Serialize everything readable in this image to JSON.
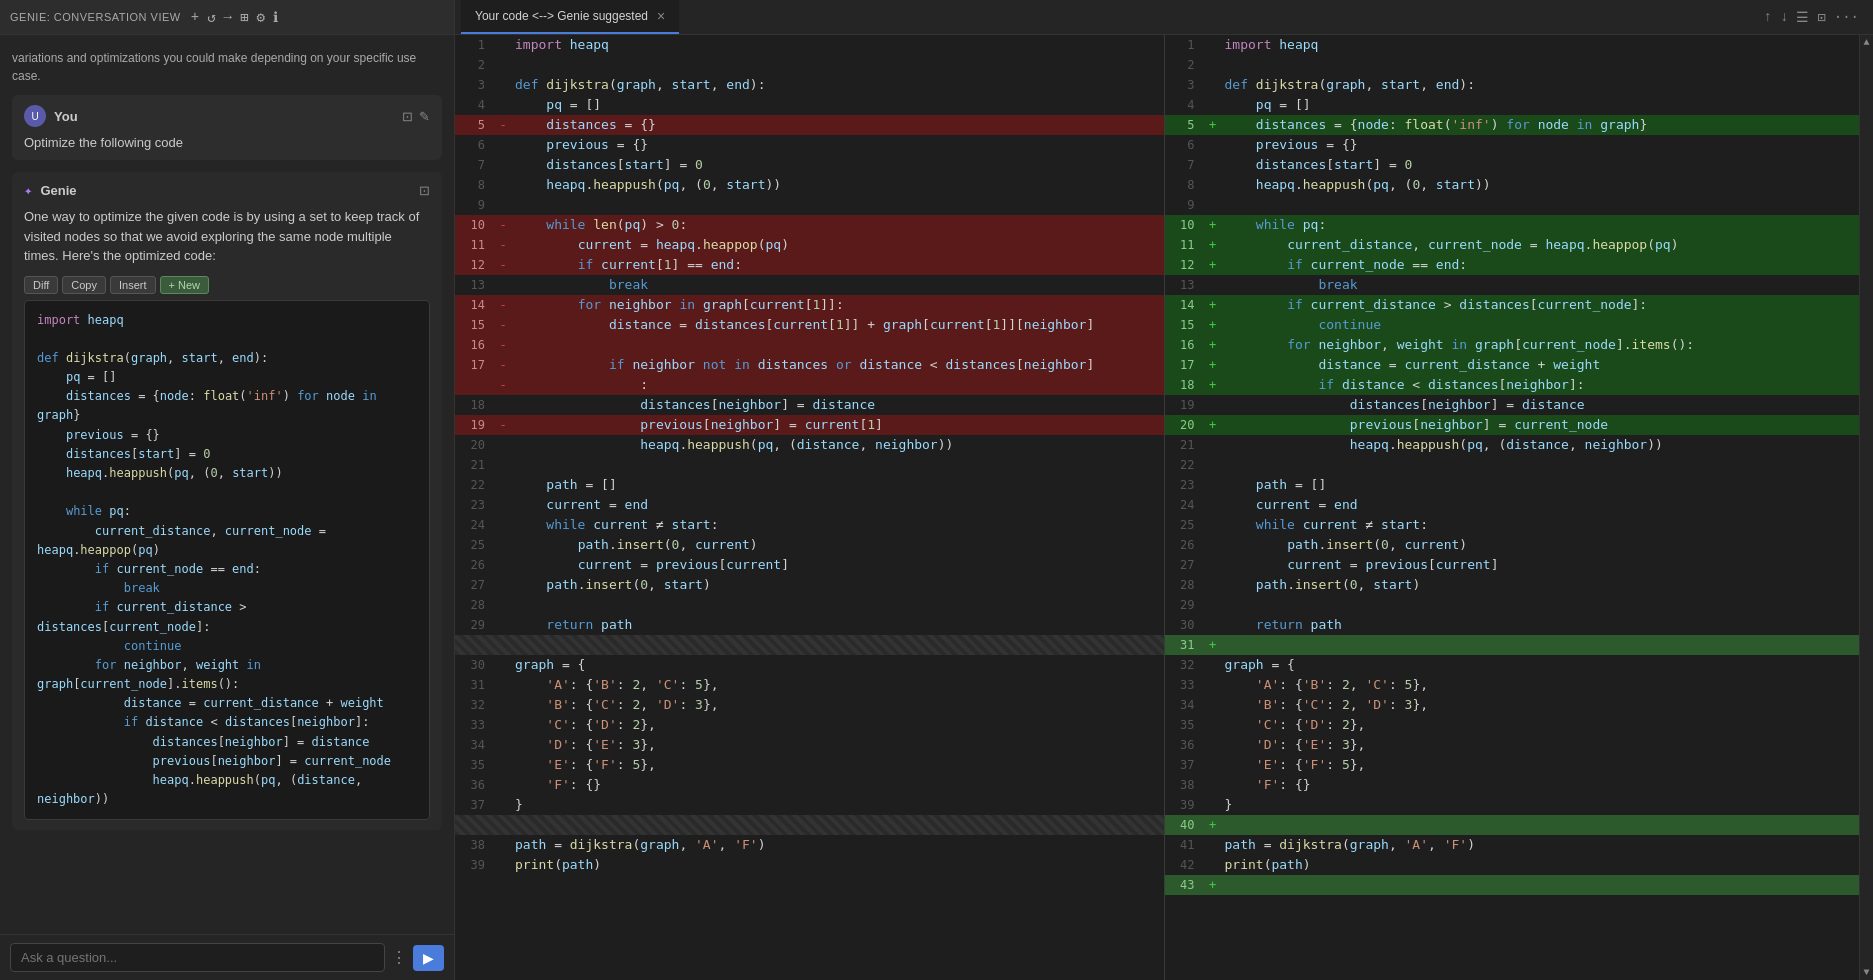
{
  "topbar": {
    "title": "GENIE: CONVERSATION VIEW",
    "icons": [
      "+",
      "↺",
      "→",
      "⊞",
      "⚙",
      "ℹ"
    ]
  },
  "tabs": {
    "items": [
      {
        "label": "Your code <--> Genie suggested",
        "active": true,
        "closable": true
      }
    ],
    "right_icons": [
      "↑",
      "↓",
      "☰",
      "⊡",
      "..."
    ]
  },
  "chat": {
    "prior_text": "variations and optimizations you could make depending on your specific use case.",
    "user": {
      "name": "You",
      "message": "Optimize the following code"
    },
    "genie": {
      "name": "Genie",
      "message": "One way to optimize the given code is by using a set to keep track of visited nodes so that we avoid exploring the same node multiple times. Here's the optimized code:",
      "toolbar": {
        "diff_label": "Diff",
        "copy_label": "Copy",
        "insert_label": "Insert",
        "new_label": "+ New"
      },
      "code": [
        "import heapq",
        "",
        "def dijkstra(graph, start, end):",
        "    pq = []",
        "    distances = {node: float('inf') for node in graph}",
        "    previous = {}",
        "    distances[start] = 0",
        "    heapq.heappush(pq, (0, start))",
        "",
        "    while pq:",
        "        current_distance, current_node = heapq.heappop(pq)",
        "        if current_node == end:",
        "            break",
        "        if current_distance > distances[current_node]:",
        "            continue",
        "        for neighbor, weight in graph[current_node].items():",
        "            distance = current_distance + weight",
        "            if distance < distances[neighbor]:",
        "                distances[neighbor] = distance",
        "                previous[neighbor] = current_node",
        "                heapq.heappush(pq, (distance, neighbor))"
      ]
    },
    "input_placeholder": "Ask a question..."
  },
  "left_panel_lines": [
    {
      "num": "1",
      "marker": "",
      "code": "import heapq",
      "type": "normal"
    },
    {
      "num": "2",
      "marker": "",
      "code": "",
      "type": "normal"
    },
    {
      "num": "3",
      "marker": "",
      "code": "def dijkstra(graph, start, end):",
      "type": "normal"
    },
    {
      "num": "4",
      "marker": "",
      "code": "    pq = []",
      "type": "normal"
    },
    {
      "num": "5",
      "marker": "-",
      "code": "    distances = {}",
      "type": "removed"
    },
    {
      "num": "6",
      "marker": "",
      "code": "    previous = {}",
      "type": "normal"
    },
    {
      "num": "7",
      "marker": "",
      "code": "    distances[start] = 0",
      "type": "normal"
    },
    {
      "num": "8",
      "marker": "",
      "code": "    heapq.heappush(pq, (0, start))",
      "type": "normal"
    },
    {
      "num": "9",
      "marker": "",
      "code": "",
      "type": "normal"
    },
    {
      "num": "10",
      "marker": "-",
      "code": "    while len(pq) > 0:",
      "type": "removed"
    },
    {
      "num": "11",
      "marker": "-",
      "code": "        current = heapq.heappop(pq)",
      "type": "removed"
    },
    {
      "num": "12",
      "marker": "-",
      "code": "        if current[1] == end:",
      "type": "removed"
    },
    {
      "num": "13",
      "marker": "",
      "code": "            break",
      "type": "normal"
    },
    {
      "num": "14",
      "marker": "-",
      "code": "        for neighbor in graph[current[1]]:",
      "type": "removed"
    },
    {
      "num": "15",
      "marker": "-",
      "code": "            distance = distances[current[1]] + graph[current[1]][neighbor]",
      "type": "removed"
    },
    {
      "num": "16",
      "marker": "-",
      "code": "",
      "type": "removed"
    },
    {
      "num": "17",
      "marker": "-",
      "code": "            if neighbor not in distances or distance < distances[neighbor]",
      "type": "removed"
    },
    {
      "num": "",
      "marker": "",
      "code": "                :",
      "type": "removed"
    },
    {
      "num": "18",
      "marker": "",
      "code": "                distances[neighbor] = distance",
      "type": "normal"
    },
    {
      "num": "19",
      "marker": "-",
      "code": "                previous[neighbor] = current[1]",
      "type": "removed"
    },
    {
      "num": "20",
      "marker": "",
      "code": "                heapq.heappush(pq, (distance, neighbor))",
      "type": "normal"
    },
    {
      "num": "21",
      "marker": "",
      "code": "",
      "type": "normal"
    },
    {
      "num": "22",
      "marker": "",
      "code": "    path = []",
      "type": "normal"
    },
    {
      "num": "23",
      "marker": "",
      "code": "    current = end",
      "type": "normal"
    },
    {
      "num": "24",
      "marker": "",
      "code": "    while current ≠ start:",
      "type": "normal"
    },
    {
      "num": "25",
      "marker": "",
      "code": "        path.insert(0, current)",
      "type": "normal"
    },
    {
      "num": "26",
      "marker": "",
      "code": "        current = previous[current]",
      "type": "normal"
    },
    {
      "num": "27",
      "marker": "",
      "code": "    path.insert(0, start)",
      "type": "normal"
    },
    {
      "num": "28",
      "marker": "",
      "code": "",
      "type": "normal"
    },
    {
      "num": "29",
      "marker": "",
      "code": "    return path",
      "type": "normal"
    },
    {
      "num": "",
      "marker": "",
      "code": "",
      "type": "separator"
    },
    {
      "num": "30",
      "marker": "",
      "code": "graph = {",
      "type": "normal"
    },
    {
      "num": "31",
      "marker": "",
      "code": "    'A': {'B': 2, 'C': 5},",
      "type": "normal"
    },
    {
      "num": "32",
      "marker": "",
      "code": "    'B': {'C': 2, 'D': 3},",
      "type": "normal"
    },
    {
      "num": "33",
      "marker": "",
      "code": "    'C': {'D': 2},",
      "type": "normal"
    },
    {
      "num": "34",
      "marker": "",
      "code": "    'D': {'E': 3},",
      "type": "normal"
    },
    {
      "num": "35",
      "marker": "",
      "code": "    'E': {'F': 5},",
      "type": "normal"
    },
    {
      "num": "36",
      "marker": "",
      "code": "    'F': {}",
      "type": "normal"
    },
    {
      "num": "37",
      "marker": "",
      "code": "}",
      "type": "normal"
    },
    {
      "num": "",
      "marker": "",
      "code": "",
      "type": "separator"
    },
    {
      "num": "38",
      "marker": "",
      "code": "path = dijkstra(graph, 'A', 'F')",
      "type": "normal"
    },
    {
      "num": "39",
      "marker": "",
      "code": "print(path)",
      "type": "normal"
    }
  ],
  "right_panel_lines": [
    {
      "num": "1",
      "marker": "",
      "code": "import heapq",
      "type": "normal"
    },
    {
      "num": "2",
      "marker": "",
      "code": "",
      "type": "normal"
    },
    {
      "num": "3",
      "marker": "",
      "code": "def dijkstra(graph, start, end):",
      "type": "normal"
    },
    {
      "num": "4",
      "marker": "",
      "code": "    pq = []",
      "type": "normal"
    },
    {
      "num": "5",
      "marker": "+",
      "code": "    distances = {node: float('inf') for node in graph}",
      "type": "added"
    },
    {
      "num": "6",
      "marker": "",
      "code": "    previous = {}",
      "type": "normal"
    },
    {
      "num": "7",
      "marker": "",
      "code": "    distances[start] = 0",
      "type": "normal"
    },
    {
      "num": "8",
      "marker": "",
      "code": "    heapq.heappush(pq, (0, start))",
      "type": "normal"
    },
    {
      "num": "9",
      "marker": "",
      "code": "",
      "type": "normal"
    },
    {
      "num": "10",
      "marker": "+",
      "code": "    while pq:",
      "type": "added"
    },
    {
      "num": "11",
      "marker": "+",
      "code": "        current_distance, current_node = heapq.heappop(pq)",
      "type": "added"
    },
    {
      "num": "12",
      "marker": "+",
      "code": "        if current_node == end:",
      "type": "added"
    },
    {
      "num": "13",
      "marker": "",
      "code": "            break",
      "type": "normal"
    },
    {
      "num": "14",
      "marker": "+",
      "code": "        if current_distance > distances[current_node]:",
      "type": "added"
    },
    {
      "num": "15",
      "marker": "+",
      "code": "            continue",
      "type": "added"
    },
    {
      "num": "16",
      "marker": "+",
      "code": "        for neighbor, weight in graph[current_node].items():",
      "type": "added"
    },
    {
      "num": "17",
      "marker": "+",
      "code": "            distance = current_distance + weight",
      "type": "added"
    },
    {
      "num": "18",
      "marker": "+",
      "code": "            if distance < distances[neighbor]:",
      "type": "added"
    },
    {
      "num": "19",
      "marker": "",
      "code": "                distances[neighbor] = distance",
      "type": "normal"
    },
    {
      "num": "20",
      "marker": "+",
      "code": "                previous[neighbor] = current_node",
      "type": "added"
    },
    {
      "num": "21",
      "marker": "",
      "code": "                heapq.heappush(pq, (distance, neighbor))",
      "type": "normal"
    },
    {
      "num": "22",
      "marker": "",
      "code": "",
      "type": "normal"
    },
    {
      "num": "23",
      "marker": "",
      "code": "    path = []",
      "type": "normal"
    },
    {
      "num": "24",
      "marker": "",
      "code": "    current = end",
      "type": "normal"
    },
    {
      "num": "25",
      "marker": "",
      "code": "    while current ≠ start:",
      "type": "normal"
    },
    {
      "num": "26",
      "marker": "",
      "code": "        path.insert(0, current)",
      "type": "normal"
    },
    {
      "num": "27",
      "marker": "",
      "code": "        current = previous[current]",
      "type": "normal"
    },
    {
      "num": "28",
      "marker": "",
      "code": "    path.insert(0, start)",
      "type": "normal"
    },
    {
      "num": "29",
      "marker": "",
      "code": "",
      "type": "normal"
    },
    {
      "num": "30",
      "marker": "",
      "code": "    return path",
      "type": "normal"
    },
    {
      "num": "31",
      "marker": "+",
      "code": "",
      "type": "added-bright"
    },
    {
      "num": "32",
      "marker": "",
      "code": "graph = {",
      "type": "normal"
    },
    {
      "num": "33",
      "marker": "",
      "code": "    'A': {'B': 2, 'C': 5},",
      "type": "normal"
    },
    {
      "num": "34",
      "marker": "",
      "code": "    'B': {'C': 2, 'D': 3},",
      "type": "normal"
    },
    {
      "num": "35",
      "marker": "",
      "code": "    'C': {'D': 2},",
      "type": "normal"
    },
    {
      "num": "36",
      "marker": "",
      "code": "    'D': {'E': 3},",
      "type": "normal"
    },
    {
      "num": "37",
      "marker": "",
      "code": "    'E': {'F': 5},",
      "type": "normal"
    },
    {
      "num": "38",
      "marker": "",
      "code": "    'F': {}",
      "type": "normal"
    },
    {
      "num": "39",
      "marker": "",
      "code": "}",
      "type": "normal"
    },
    {
      "num": "40",
      "marker": "+",
      "code": "",
      "type": "added-bright"
    },
    {
      "num": "41",
      "marker": "",
      "code": "path = dijkstra(graph, 'A', 'F')",
      "type": "normal"
    },
    {
      "num": "42",
      "marker": "",
      "code": "print(path)",
      "type": "normal"
    },
    {
      "num": "43",
      "marker": "+",
      "code": "",
      "type": "added-bright"
    }
  ]
}
